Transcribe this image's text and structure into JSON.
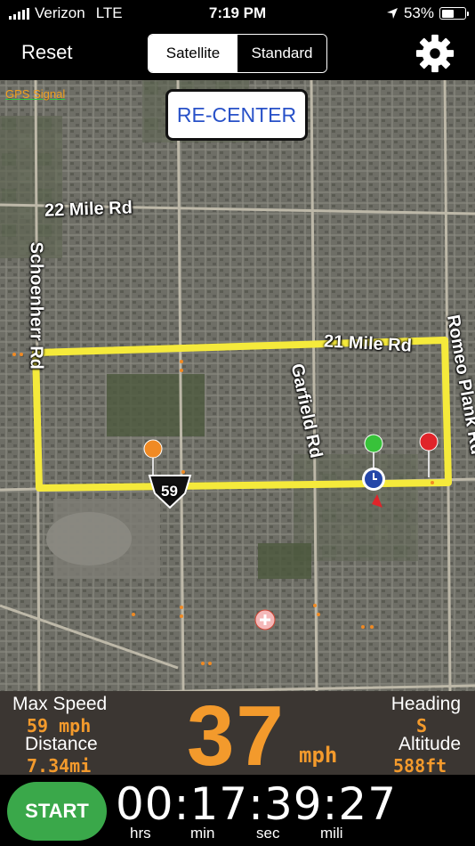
{
  "status_bar": {
    "carrier": "Verizon",
    "network": "LTE",
    "time": "7:19 PM",
    "battery": "53%",
    "battery_level": 0.53,
    "location_icon": "location-arrow-icon"
  },
  "top_bar": {
    "reset_label": "Reset",
    "map_modes": [
      {
        "label": "Satellite",
        "selected": true
      },
      {
        "label": "Standard",
        "selected": false
      }
    ],
    "settings_icon": "gear-icon"
  },
  "map": {
    "gps_label": "GPS Signal",
    "recenter_label": "RE-CENTER",
    "road_labels": {
      "r22": "22 Mile Rd",
      "schoenherr": "Schoenherr Rd",
      "garfield": "Garfield Rd",
      "r21": "21 Mile Rd",
      "romeo": "Romeo Plank Rd",
      "shield": "59"
    },
    "colors": {
      "route": "#f5ea3b",
      "pin_green": "#38c23a",
      "pin_red": "#e0242a",
      "pin_orange": "#f08a24",
      "location_dot": "#2446a8"
    }
  },
  "stats": {
    "max_speed_label": "Max Speed",
    "max_speed_value": "59 mph",
    "distance_label": "Distance",
    "distance_value": "7.34mi",
    "speed": "37",
    "speed_unit": "mph",
    "heading_label": "Heading",
    "heading_value": "S",
    "altitude_label": "Altitude",
    "altitude_value": "588ft"
  },
  "bottom": {
    "start_label": "START",
    "timer": "00:17:39:27",
    "units": {
      "hrs": "hrs",
      "min": "min",
      "sec": "sec",
      "mili": "mili"
    }
  }
}
